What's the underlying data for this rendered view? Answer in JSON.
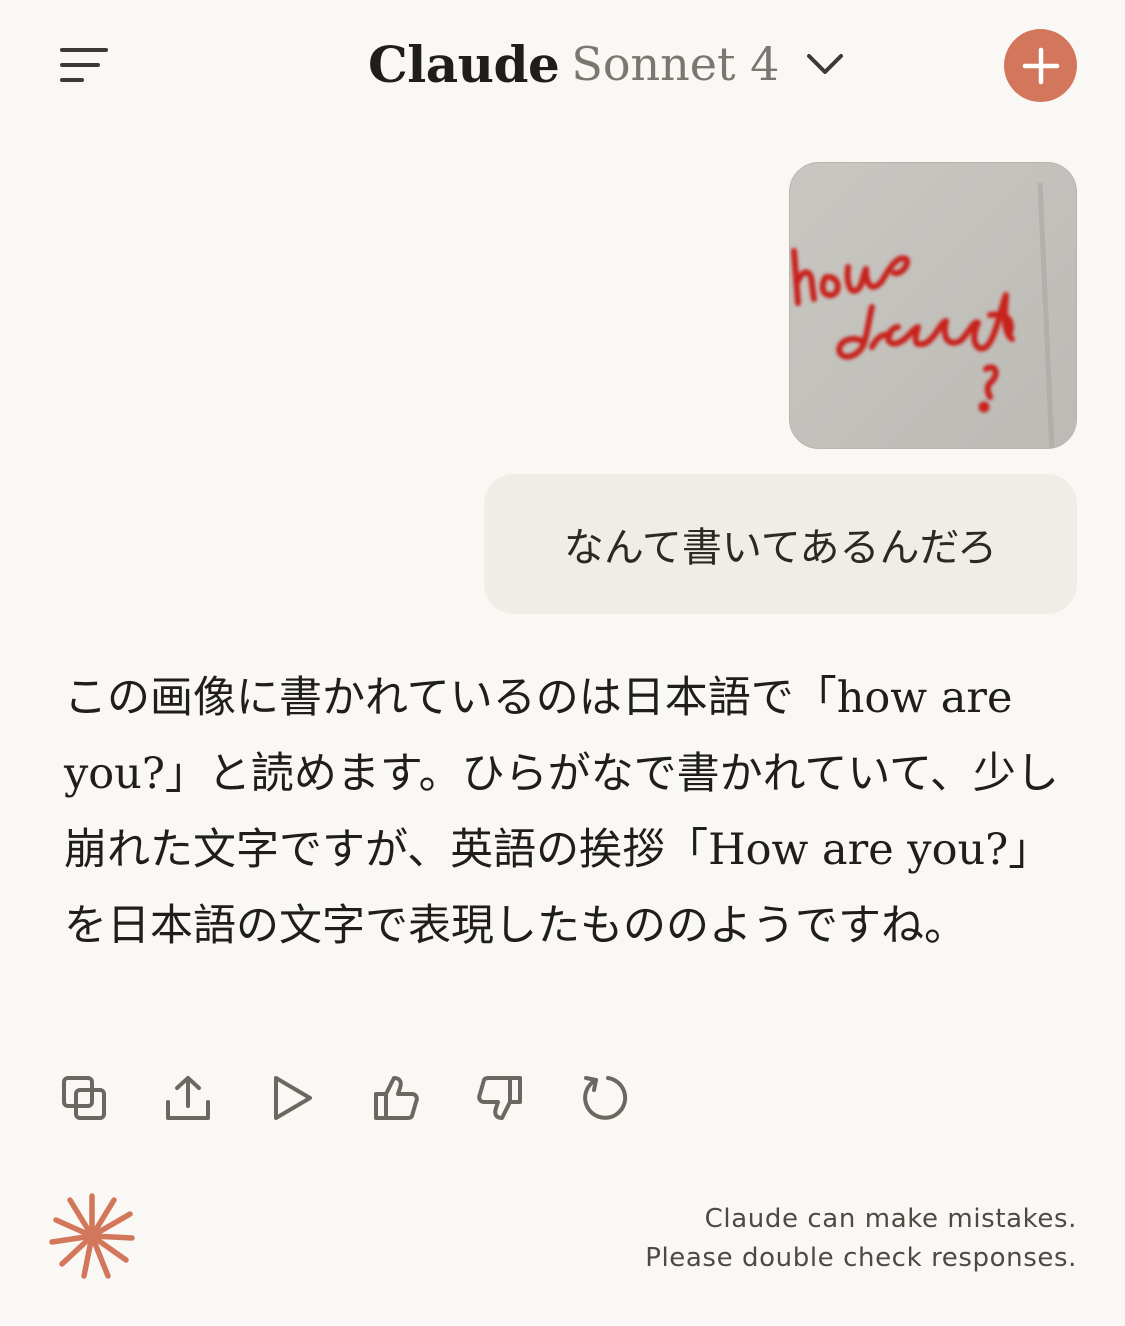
{
  "header": {
    "brand": "Claude",
    "model": "Sonnet 4",
    "menu_icon": "hamburger-menu-icon",
    "dropdown_icon": "chevron-down-icon",
    "new_chat_icon": "plus-icon",
    "accent_color": "#d3775c"
  },
  "conversation": {
    "user_image": {
      "handwritten_text": "how are you?",
      "ink_color": "#c8231f"
    },
    "user_message": "なんて書いてあるんだろ",
    "assistant_message": "この画像に書かれているのは日本語で「how are you?」と読めます。ひらがなで書かれていて、少し崩れた文字ですが、英語の挨拶「How are you?」を日本語の文字で表現したもののようですね。"
  },
  "actions": [
    {
      "icon": "copy-icon"
    },
    {
      "icon": "share-icon"
    },
    {
      "icon": "play-icon"
    },
    {
      "icon": "thumbs-up-icon"
    },
    {
      "icon": "thumbs-down-icon"
    },
    {
      "icon": "retry-icon"
    }
  ],
  "footer": {
    "logo_icon": "claude-spark-icon",
    "disclaimer_line1": "Claude can make mistakes.",
    "disclaimer_line2": "Please double check responses."
  }
}
